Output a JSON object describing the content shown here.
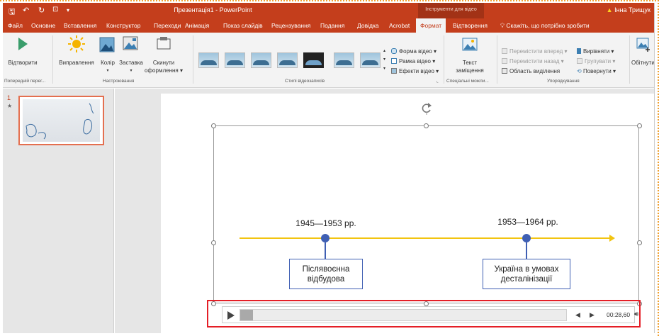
{
  "titlebar": {
    "quick_access": [
      "🖫",
      "↶",
      "↻",
      "⊡"
    ],
    "title": "Презентація1  -  PowerPoint",
    "context_tools": "Інструменти для відео",
    "user_name": "Інна Трищук"
  },
  "tabs": [
    {
      "label": "Файл"
    },
    {
      "label": "Основне"
    },
    {
      "label": "Вставлення"
    },
    {
      "label": "Конструктор"
    },
    {
      "label": "Переходи"
    },
    {
      "label": "Анімація"
    },
    {
      "label": "Показ слайдів"
    },
    {
      "label": "Рецензування"
    },
    {
      "label": "Подання"
    },
    {
      "label": "Довідка"
    },
    {
      "label": "Acrobat"
    },
    {
      "label": "Формат"
    },
    {
      "label": "Відтворення"
    }
  ],
  "active_tab": "Формат",
  "tell_me": "Скажіть, що потрібно зробити",
  "ribbon": {
    "play_label": "Відтворити",
    "corrections": "Виправлення",
    "color": "Колір",
    "poster": "Заставка",
    "reset_1": "Скинути",
    "reset_2": "оформлення",
    "shape": "Форма відео",
    "border": "Рамка відео",
    "effects": "Ефекти відео",
    "alt_text_1": "Текст",
    "alt_text_2": "заміщення",
    "bring_forward": "Перемістити вперед",
    "send_backward": "Перемістити назад",
    "selection_pane": "Область виділення",
    "align": "Вирівняти",
    "group": "Групувати",
    "rotate": "Повернути",
    "crop": "Обітнути",
    "groups": {
      "preview": "Попередній перег...",
      "adjust": "Настроювання",
      "styles": "Стилі відеозаписів",
      "accessibility": "Спеціальні можли...",
      "arrange": "Упорядкування"
    }
  },
  "thumbnails": {
    "slide_number": "1",
    "animation_marker": "★"
  },
  "slide": {
    "period_1": "1945—1953 рр.",
    "period_2": "1953—1964 рр.",
    "box_1_line1": "Післявоєнна",
    "box_1_line2": "відбудова",
    "box_2_line1": "Україна в умовах",
    "box_2_line2": "десталінізації"
  },
  "player": {
    "time": "00:28,60",
    "progress_fraction": 0.04
  },
  "colors": {
    "brand": "#c43e1c",
    "timeline": "#f2c410",
    "marker": "#3f5fb3",
    "highlight": "#e41e26"
  }
}
